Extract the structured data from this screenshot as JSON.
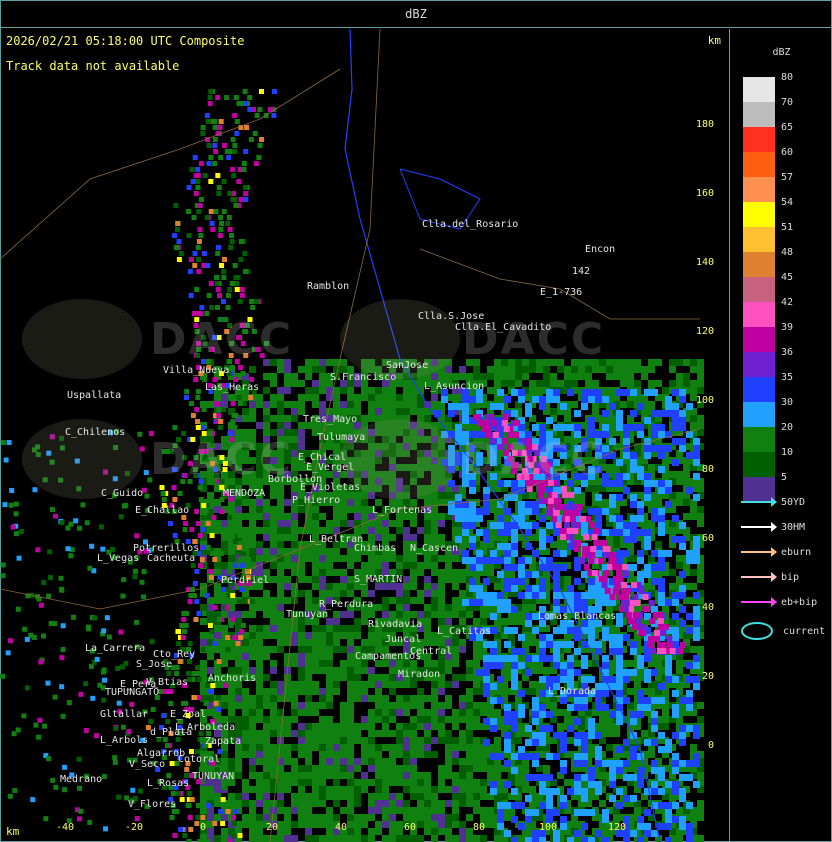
{
  "window": {
    "title": "dBZ"
  },
  "plot": {
    "timestamp": "2026/02/21 05:18:00 UTC Composite",
    "track_status": "Track data not available",
    "km_label_top": "km",
    "km_label_bottom": "km",
    "y_ticks": [
      "180",
      "160",
      "140",
      "120",
      "100",
      "80",
      "60",
      "40",
      "20",
      "0"
    ],
    "x_ticks": [
      "-40",
      "-20",
      "0",
      "20",
      "40",
      "60",
      "80",
      "100",
      "120"
    ],
    "watermark": "DACC",
    "places": [
      "Clla.del_Rosario",
      "Encon",
      "142",
      "E_1-736",
      "Ramblon",
      "Clla.S.Jose",
      "Clla.El_Cavadito",
      "Villa_Nueva",
      "Las_Heras",
      "Uspallata",
      "S.Francisco",
      "SanJose",
      "L_Asuncion",
      "C_Chilenos",
      "Tres_Mayo",
      "Tulumaya",
      "C_Guido",
      "E_Chical",
      "E_Vergel",
      "Borbollon",
      "E_Violetas",
      "P_Hierro",
      "L_Fortenas",
      "E_Challao",
      "MENDOZA",
      "Potrerillos",
      "L_Vegas",
      "Cacheuta",
      "Perdriel",
      "L_Beltran",
      "Chimbas",
      "N_Cascen",
      "S_MARTIN",
      "R_Perdura",
      "Tunuyan",
      "La_Carrera",
      "Cto_Rey",
      "S_Jose",
      "E_Pera",
      "V_Btias",
      "Anchoris",
      "TUPUNGATO",
      "E_Zpal",
      "L_Arboleda",
      "Gltallar",
      "L_Arbols",
      "d_Plata",
      "Zapata",
      "Algarrob",
      "V_Seco",
      "Cotoral",
      "L_Rosas",
      "TUNUYAN",
      "V_Flores",
      "Campamentos",
      "Central",
      "Miradon",
      "Lomas_Blancas",
      "L_Dorada",
      "L_Catitas",
      "Medrano",
      "Rivadavia",
      "Juncal"
    ]
  },
  "legend": {
    "title": "dBZ",
    "levels": [
      {
        "label": "80",
        "color": "#e6e6e6"
      },
      {
        "label": "70",
        "color": "#bdbdbd"
      },
      {
        "label": "65",
        "color": "#ff3020"
      },
      {
        "label": "60",
        "color": "#ff6010"
      },
      {
        "label": "57",
        "color": "#ff9050"
      },
      {
        "label": "54",
        "color": "#ffff00"
      },
      {
        "label": "51",
        "color": "#ffc030"
      },
      {
        "label": "48",
        "color": "#e08030"
      },
      {
        "label": "45",
        "color": "#c86080"
      },
      {
        "label": "42",
        "color": "#ff50c0"
      },
      {
        "label": "39",
        "color": "#c000a0"
      },
      {
        "label": "36",
        "color": "#7020d0"
      },
      {
        "label": "35",
        "color": "#2040ff"
      },
      {
        "label": "30",
        "color": "#20a0ff"
      },
      {
        "label": "20",
        "color": "#108010"
      },
      {
        "label": "10",
        "color": "#006000"
      },
      {
        "label": "5",
        "color": "#503090"
      }
    ],
    "track_keys": [
      {
        "label": "50YD",
        "color": "#40e0e0"
      },
      {
        "label": "30HM",
        "color": "#ffffff"
      },
      {
        "label": "eburn",
        "color": "#ffc080"
      },
      {
        "label": "bip",
        "color": "#ffc0c0"
      },
      {
        "label": "eb+bip",
        "color": "#ff40ff"
      },
      {
        "label": "current",
        "color": "#40e0e0"
      }
    ]
  }
}
